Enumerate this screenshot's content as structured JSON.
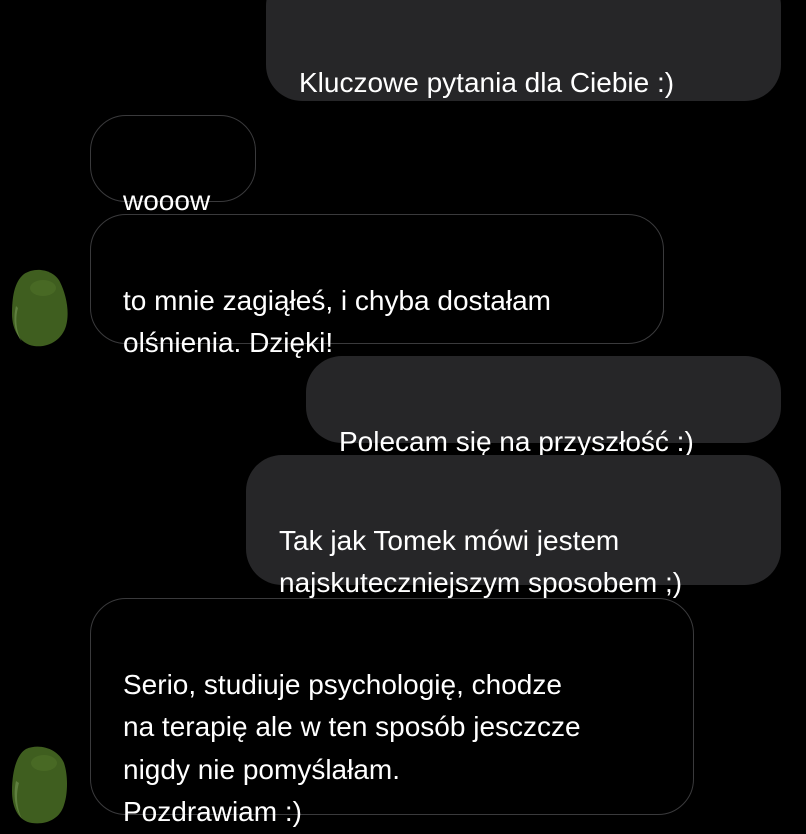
{
  "colors": {
    "background": "#000000",
    "sent_bubble": "#262628",
    "received_border": "#3a3a3c",
    "text": "#ffffff",
    "avatar": "#3f5e1f"
  },
  "messages": [
    {
      "side": "sent",
      "text": "Kluczowe pytania dla Ciebie :)"
    },
    {
      "side": "received",
      "text": "wooow"
    },
    {
      "side": "received",
      "text": "to mnie zagiąłeś, i chyba dostałam\nolśnienia. Dzięki!"
    },
    {
      "side": "sent",
      "text": "Polecam się na przyszłość :)"
    },
    {
      "side": "sent",
      "text": "Tak jak Tomek mówi jestem\nnajskuteczniejszym sposobem ;)"
    },
    {
      "side": "received",
      "text": "Serio, studiuje psychologię, chodze\nna terapię ale w ten sposób jesczcze\nnigdy nie pomyślałam.\nPozdrawiam :)"
    }
  ]
}
